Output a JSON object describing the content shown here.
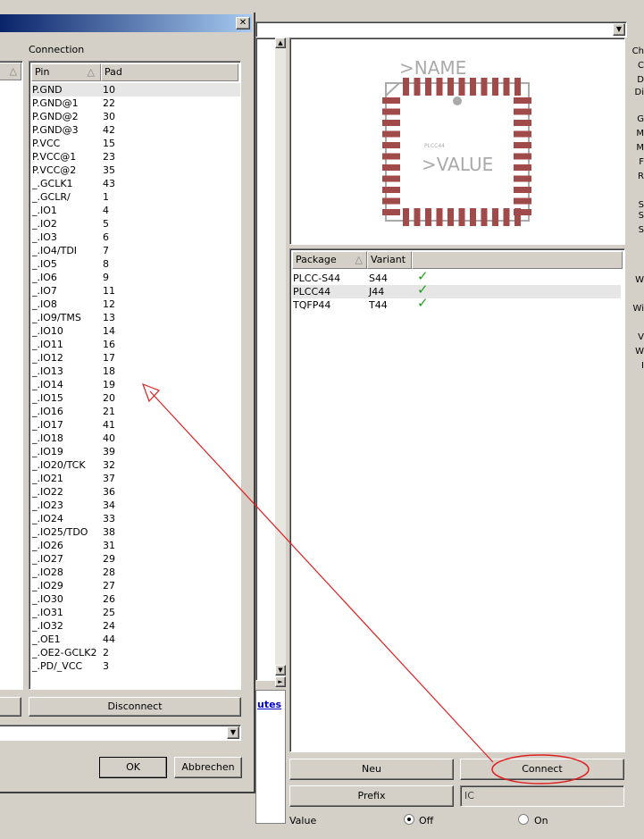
{
  "dialog": {
    "close_glyph": "✕",
    "connection_label": "Connection",
    "pin_header": "Pin",
    "pad_header": "Pad",
    "pins": [
      {
        "pin": "P.GND",
        "pad": "10"
      },
      {
        "pin": "P.GND@1",
        "pad": "22"
      },
      {
        "pin": "P.GND@2",
        "pad": "30"
      },
      {
        "pin": "P.GND@3",
        "pad": "42"
      },
      {
        "pin": "P.VCC",
        "pad": "15"
      },
      {
        "pin": "P.VCC@1",
        "pad": "23"
      },
      {
        "pin": "P.VCC@2",
        "pad": "35"
      },
      {
        "pin": "_.GCLK1",
        "pad": "43"
      },
      {
        "pin": "_.GCLR/",
        "pad": "1"
      },
      {
        "pin": "_.IO1",
        "pad": "4"
      },
      {
        "pin": "_.IO2",
        "pad": "5"
      },
      {
        "pin": "_.IO3",
        "pad": "6"
      },
      {
        "pin": "_.IO4/TDI",
        "pad": "7"
      },
      {
        "pin": "_.IO5",
        "pad": "8"
      },
      {
        "pin": "_.IO6",
        "pad": "9"
      },
      {
        "pin": "_.IO7",
        "pad": "11"
      },
      {
        "pin": "_.IO8",
        "pad": "12"
      },
      {
        "pin": "_.IO9/TMS",
        "pad": "13"
      },
      {
        "pin": "_.IO10",
        "pad": "14"
      },
      {
        "pin": "_.IO11",
        "pad": "16"
      },
      {
        "pin": "_.IO12",
        "pad": "17"
      },
      {
        "pin": "_.IO13",
        "pad": "18"
      },
      {
        "pin": "_.IO14",
        "pad": "19"
      },
      {
        "pin": "_.IO15",
        "pad": "20"
      },
      {
        "pin": "_.IO16",
        "pad": "21"
      },
      {
        "pin": "_.IO17",
        "pad": "41"
      },
      {
        "pin": "_.IO18",
        "pad": "40"
      },
      {
        "pin": "_.IO19",
        "pad": "39"
      },
      {
        "pin": "_.IO20/TCK",
        "pad": "32"
      },
      {
        "pin": "_.IO21",
        "pad": "37"
      },
      {
        "pin": "_.IO22",
        "pad": "36"
      },
      {
        "pin": "_.IO23",
        "pad": "34"
      },
      {
        "pin": "_.IO24",
        "pad": "33"
      },
      {
        "pin": "_.IO25/TDO",
        "pad": "38"
      },
      {
        "pin": "_.IO26",
        "pad": "31"
      },
      {
        "pin": "_.IO27",
        "pad": "29"
      },
      {
        "pin": "_.IO28",
        "pad": "28"
      },
      {
        "pin": "_.IO29",
        "pad": "27"
      },
      {
        "pin": "_.IO30",
        "pad": "26"
      },
      {
        "pin": "_.IO31",
        "pad": "25"
      },
      {
        "pin": "_.IO32",
        "pad": "24"
      },
      {
        "pin": "_.OE1",
        "pad": "44"
      },
      {
        "pin": "_.OE2-GCLK2",
        "pad": "2"
      },
      {
        "pin": "_.PD/_VCC",
        "pad": "3"
      }
    ],
    "disconnect_label": "Disconnect",
    "ok_label": "OK",
    "cancel_label": "Abbrechen"
  },
  "preview": {
    "name_text": ">NAME",
    "value_text": ">VALUE",
    "package_text": "PLCC44"
  },
  "packages": {
    "headers": {
      "package": "Package",
      "variant": "Variant"
    },
    "rows": [
      {
        "package": "PLCC-S44",
        "variant": "S44",
        "check": "✓"
      },
      {
        "package": "PLCC44",
        "variant": "J44",
        "check": "✓"
      },
      {
        "package": "TQFP44",
        "variant": "T44",
        "check": "✓"
      }
    ]
  },
  "bottom": {
    "link_text": "utes",
    "neu_label": "Neu",
    "connect_label": "Connect",
    "prefix_label": "Prefix",
    "prefix_value": "IC",
    "value_label": "Value",
    "off_label": "Off",
    "on_label": "On"
  },
  "right_strip_letters": [
    "Ch",
    "C",
    "D",
    "Di",
    "G",
    "M",
    "M",
    "F",
    "R",
    "S",
    "S",
    "S",
    "W",
    "Wi",
    "V",
    "W",
    "I"
  ],
  "colors": {
    "pad": "#a04a4a",
    "annotation": "#e02020",
    "check": "#20a020"
  }
}
